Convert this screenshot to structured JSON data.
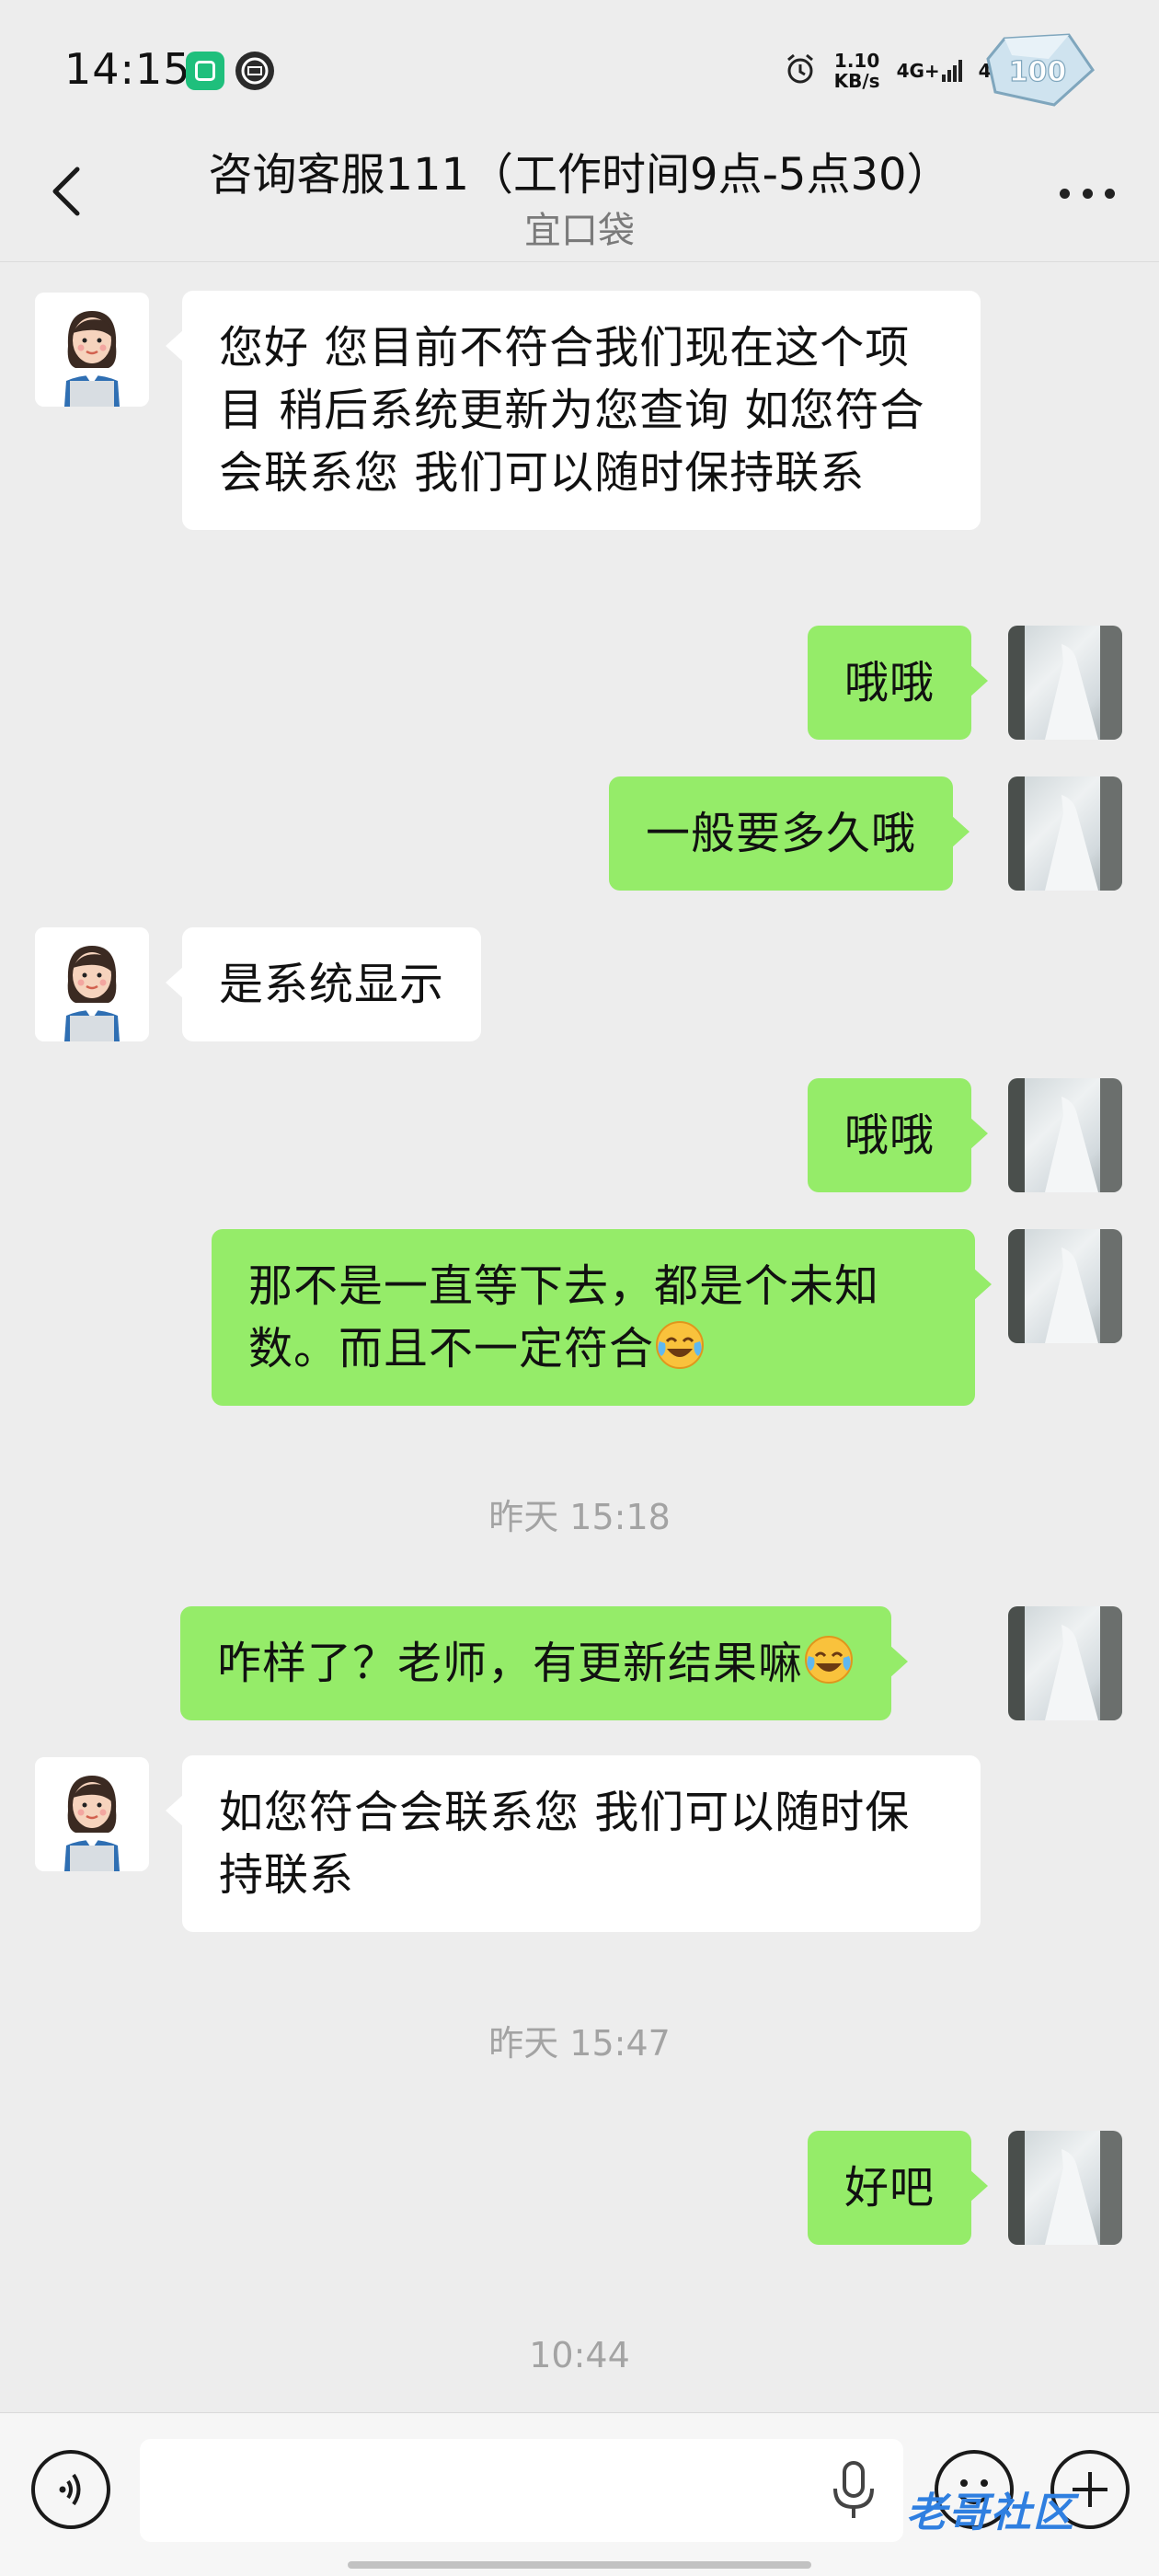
{
  "status_bar": {
    "time": "14:15",
    "net_speed_value": "1.10",
    "net_speed_unit": "KB/s",
    "sim1": "4G+",
    "sim2": "4G",
    "battery": "100"
  },
  "header": {
    "title": "咨询客服111（工作时间9点-5点30）",
    "subtitle": "宜口袋"
  },
  "messages": [
    {
      "from": "cs",
      "text": "您好 您目前不符合我们现在这个项目  稍后系统更新为您查询 如您符合会联系您  我们可以随时保持联系"
    },
    {
      "from": "me",
      "text": "哦哦"
    },
    {
      "from": "me",
      "text": "一般要多久哦"
    },
    {
      "from": "cs",
      "text": "是系统显示"
    },
    {
      "from": "me",
      "text": "哦哦"
    },
    {
      "from": "me",
      "text": "那不是一直等下去，都是个未知数。而且不一定符合"
    },
    {
      "from": "me",
      "text": "咋样了？老师，有更新结果嘛"
    },
    {
      "from": "cs",
      "text": "如您符合会联系您  我们可以随时保持联系"
    },
    {
      "from": "me",
      "text": "好吧"
    }
  ],
  "timestamps": [
    "昨天 15:18",
    "昨天 15:47",
    "10:44"
  ],
  "input": {
    "value": "",
    "placeholder": ""
  },
  "watermark": "老哥社区",
  "colors": {
    "background": "#ededed",
    "my_bubble": "#95ec69",
    "their_bubble": "#ffffff"
  }
}
